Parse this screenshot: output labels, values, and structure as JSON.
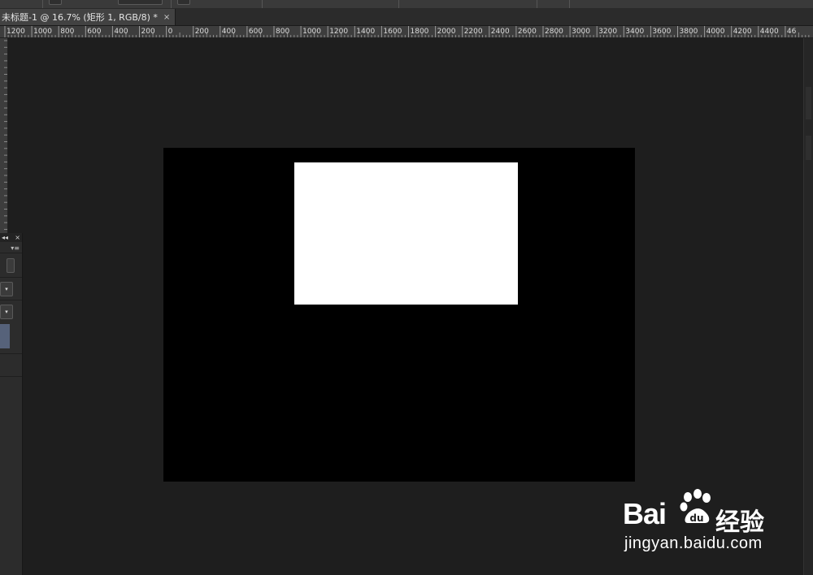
{
  "document": {
    "tab_title": "未标题-1 @ 16.7% (矩形 1, RGB/8) *",
    "close_glyph": "×"
  },
  "ruler": {
    "unit": "px",
    "labels": [
      "1200",
      "1000",
      "800",
      "600",
      "400",
      "200",
      "0",
      "200",
      "400",
      "600",
      "800",
      "1000",
      "1200",
      "1400",
      "1600",
      "1800",
      "2000",
      "2200",
      "2400",
      "2600",
      "2800",
      "3000",
      "3200",
      "3400",
      "3600",
      "3800",
      "4000",
      "4200",
      "4400",
      "46"
    ]
  },
  "canvas": {
    "background_color": "#000000",
    "shape_color": "#ffffff",
    "workspace_color": "#1e1e1e"
  },
  "panel": {
    "collapse_glyph": "◂◂",
    "close_glyph": "×",
    "menu_glyph": "▾≡",
    "dropdown_glyph": "▾"
  },
  "watermark": {
    "brand": "Bai",
    "brand_suffix": "经验",
    "url": "jingyan.baidu.com"
  }
}
